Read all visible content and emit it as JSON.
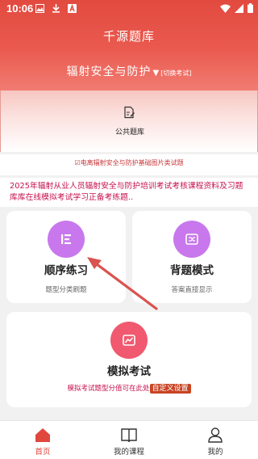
{
  "status_bar": {
    "time": "10:06"
  },
  "header": {
    "title": "千源题库",
    "subject": "辐射安全与防护",
    "subject_arrow": "▼",
    "switch_label": "[切换考试]"
  },
  "bank": {
    "label": "公共题库"
  },
  "notices": {
    "line1": "☑电离辐射安全与防护基础图片类试题",
    "line2": "2025年辐射从业人员辐射安全与防护培训考试考核课程资料及习题库库在线模拟考试学习正备考练题.."
  },
  "modes": {
    "sequential": {
      "title": "顺序练习",
      "desc": "题型分类刷题"
    },
    "memorize": {
      "title": "背题模式",
      "desc": "答案直接显示"
    },
    "mock": {
      "title": "模拟考试",
      "desc": "模拟考试题型分值可在此处",
      "link": "自定义设置"
    }
  },
  "bottom_nav": {
    "items": [
      {
        "label": "首页",
        "active": true
      },
      {
        "label": "我的课程",
        "active": false
      },
      {
        "label": "我的",
        "active": false
      }
    ]
  },
  "colors": {
    "header_red": "#e24a3f",
    "purple_icon": "#c878ec",
    "pink_icon": "#f0596f",
    "active_nav": "#e0473d",
    "pointer_arrow": "#d9534f"
  }
}
